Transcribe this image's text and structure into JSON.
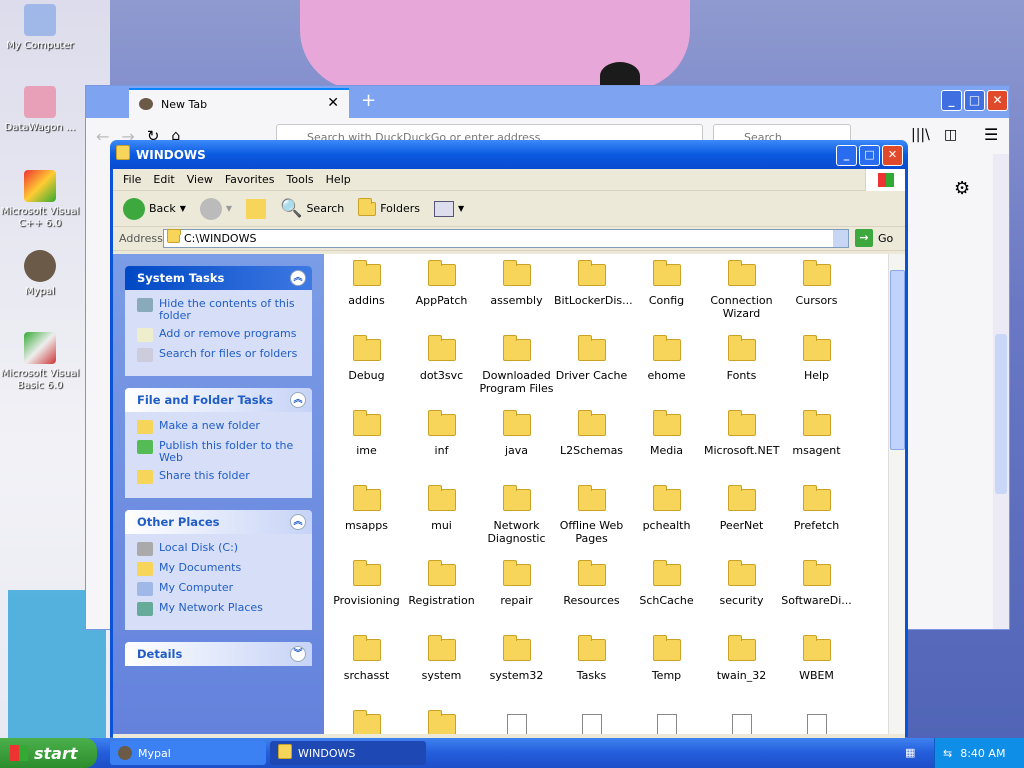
{
  "desktop": {
    "icons": [
      {
        "label": "My Computer",
        "icon": "computer-icon"
      },
      {
        "label": "DataWagon ...",
        "icon": "app-shortcut-icon"
      },
      {
        "label": "Microsoft Visual C++ 6.0",
        "icon": "visual-cpp-icon"
      },
      {
        "label": "Mypal",
        "icon": "mypal-icon"
      },
      {
        "label": "Microsoft Visual Basic 6.0",
        "icon": "visual-basic-icon"
      }
    ]
  },
  "browser": {
    "tab_title": "New Tab",
    "url_placeholder": "Search with DuckDuckGo or enter address",
    "search_placeholder": "Search"
  },
  "explorer": {
    "title": "WINDOWS",
    "menu": [
      "File",
      "Edit",
      "View",
      "Favorites",
      "Tools",
      "Help"
    ],
    "toolbar": {
      "back": "Back",
      "search": "Search",
      "folders": "Folders"
    },
    "address_label": "Address",
    "address_value": "C:\\WINDOWS",
    "go_label": "Go",
    "system_tasks": {
      "title": "System Tasks",
      "items": [
        "Hide the contents of this folder",
        "Add or remove programs",
        "Search for files or folders"
      ]
    },
    "file_tasks": {
      "title": "File and Folder Tasks",
      "items": [
        "Make a new folder",
        "Publish this folder to the Web",
        "Share this folder"
      ]
    },
    "other_places": {
      "title": "Other Places",
      "items": [
        "Local Disk (C:)",
        "My Documents",
        "My Computer",
        "My Network Places"
      ]
    },
    "details_title": "Details",
    "files": [
      "addins",
      "AppPatch",
      "assembly",
      "BitLockerDis...",
      "Config",
      "Connection Wizard",
      "Cursors",
      "Debug",
      "dot3svc",
      "Downloaded Program Files",
      "Driver Cache",
      "ehome",
      "Fonts",
      "Help",
      "ime",
      "inf",
      "java",
      "L2Schemas",
      "Media",
      "Microsoft.NET",
      "msagent",
      "msapps",
      "mui",
      "Network Diagnostic",
      "Offline Web Pages",
      "pchealth",
      "PeerNet",
      "Prefetch",
      "Provisioning",
      "Registration",
      "repair",
      "Resources",
      "SchCache",
      "security",
      "SoftwareDi...",
      "srchasst",
      "system",
      "system32",
      "Tasks",
      "Temp",
      "twain_32",
      "WBEM",
      "",
      "",
      "",
      "",
      "",
      "",
      ""
    ]
  },
  "taskbar": {
    "start_label": "start",
    "buttons": [
      "Mypal",
      "WINDOWS"
    ],
    "clock": "8:40 AM"
  },
  "colors": {
    "xp_blue": "#0a52d8",
    "taskbar_blue": "#245ddb",
    "link_blue": "#215dc6"
  }
}
